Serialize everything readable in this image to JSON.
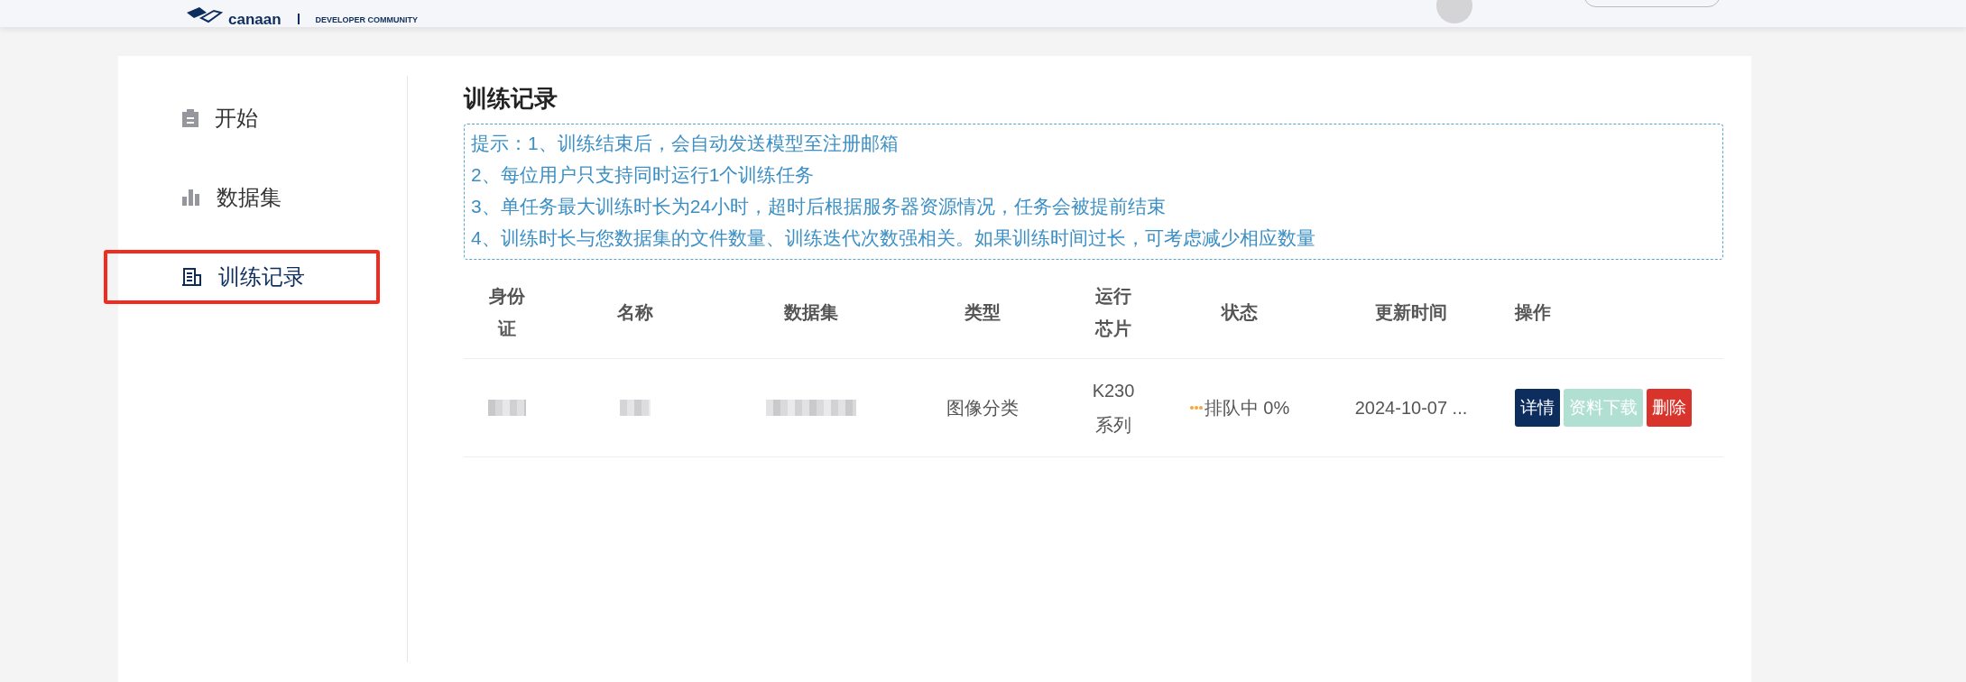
{
  "header": {
    "brand": "canaan",
    "tagline": "DEVELOPER COMMUNITY"
  },
  "sidebar": {
    "items": [
      {
        "label": "开始",
        "kind": "clipboard",
        "selected": false,
        "highlighted": false
      },
      {
        "label": "数据集",
        "kind": "bars",
        "selected": false,
        "highlighted": false
      },
      {
        "label": "训练记录",
        "kind": "ledger",
        "selected": true,
        "highlighted": true
      }
    ]
  },
  "title": "训练记录",
  "tips": [
    "提示：1、训练结束后，会自动发送模型至注册邮箱",
    "2、每位用户只支持同时运行1个训练任务",
    "3、单任务最大训练时长为24小时，超时后根据服务器资源情况，任务会被提前结束",
    "4、训练时长与您数据集的文件数量、训练迭代次数强相关。如果训练时间过长，可考虑减少相应数量"
  ],
  "table": {
    "columns": [
      "身份证",
      "名称",
      "数据集",
      "类型",
      "运行芯片",
      "状态",
      "更新时间",
      "操作"
    ],
    "rows": [
      {
        "cells": [
          {
            "kind": "redacted"
          },
          {
            "kind": "redacted"
          },
          {
            "kind": "redacted"
          },
          {
            "kind": "text",
            "text": "图像分类"
          },
          {
            "kind": "text",
            "text": "K230 系列"
          },
          {
            "kind": "status",
            "color": "#f2a93b",
            "text": "排队中 0%"
          },
          {
            "kind": "text",
            "text": "2024-10-07 ..."
          },
          {
            "kind": "actions",
            "actions": [
              {
                "label": "详情",
                "kind": "primary",
                "disabled": false
              },
              {
                "label": "资料下载",
                "kind": "success",
                "disabled": true
              },
              {
                "label": "删除",
                "kind": "danger",
                "disabled": false
              }
            ]
          }
        ]
      }
    ]
  }
}
